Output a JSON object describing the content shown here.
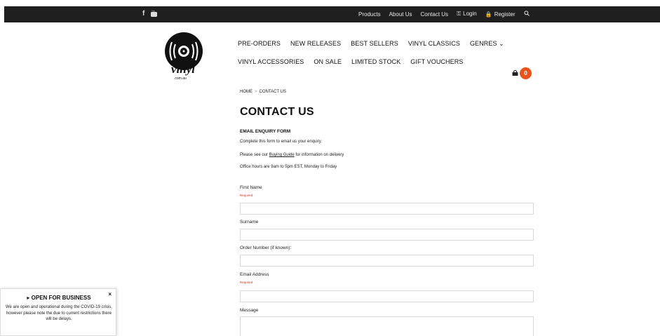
{
  "topbar": {
    "social": [
      {
        "name": "facebook-icon",
        "glyph": "f"
      },
      {
        "name": "youtube-icon",
        "glyph": "▶"
      }
    ],
    "links": {
      "products": "Products",
      "about": "About Us",
      "contact": "Contact Us",
      "login": "Login",
      "register": "Register"
    }
  },
  "logo": {
    "text": "vinyl",
    "subtext": ".com.au"
  },
  "nav": {
    "row1": [
      "PRE-ORDERS",
      "NEW RELEASES",
      "BEST SELLERS",
      "VINYL CLASSICS",
      "GENRES ⌄"
    ],
    "row2": [
      "VINYL ACCESSORIES",
      "ON SALE",
      "LIMITED STOCK",
      "GIFT VOUCHERS"
    ]
  },
  "cart": {
    "count": "0"
  },
  "breadcrumb": {
    "home": "HOME",
    "separator": ">",
    "current": "CONTACT US"
  },
  "page_title": "CONTACT US",
  "form": {
    "heading": "EMAIL ENQUIRY FORM",
    "intro": "Complete this form to email us your enquiry.",
    "guide_before": "Please see our ",
    "guide_link": "Buying Guide",
    "guide_after": " for information on delivery",
    "hours": "Office hours are 9am to 5pm EST, Monday to Friday",
    "required_text": "Required",
    "fields": {
      "first_name": "First Name",
      "surname": "Surname",
      "order_number": "Order Number (if known):",
      "email": "Email Address",
      "message": "Message"
    }
  },
  "popup": {
    "title": "▸ OPEN FOR BUSINESS",
    "close": "×",
    "body": "We are open and operational during the COVID-19 crisis, however please note the due to current restrictions there will be delays."
  },
  "colors": {
    "topbar_bg": "#1f1f1f",
    "cart_badge": "#e8531c",
    "required": "#c0392b"
  }
}
